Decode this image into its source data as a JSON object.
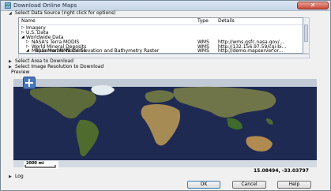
{
  "window": {
    "title": "Download Online Maps",
    "close_glyph": "✕"
  },
  "sections": {
    "data_source": "Select Data Source (right click for options)",
    "area": "Select Area to Download",
    "resolution": "Select Image Resolution to Download",
    "preview": "Preview",
    "log": "Log"
  },
  "table": {
    "headers": {
      "name": "Name",
      "type": "Type",
      "details": "Details"
    },
    "rows": [
      {
        "name": "Imagery",
        "type": "",
        "details": "",
        "expander": "▷"
      },
      {
        "name": "U.S. Data",
        "type": "",
        "details": "",
        "expander": "▷"
      },
      {
        "name": "Worldwide Data",
        "type": "",
        "details": "",
        "expander": "◢"
      },
      {
        "name": "NASA's Terra MODIS",
        "type": "WMS",
        "details": "http://wms.gsfc.nasa.gov/...",
        "expander": "▷"
      },
      {
        "name": "World Mineral Deposits",
        "type": "WMS",
        "details": "http://132.156.97.59/cgi-bi...",
        "expander": "▷"
      },
      {
        "name": "MapServer WMS Demo",
        "type": "WMS",
        "details": "http://demo.mapserver.or...",
        "expander": "◢"
      },
      {
        "name": "Blue Marble World Elevation and Bathymetry Raster",
        "type": "",
        "details": "",
        "expander": ""
      }
    ]
  },
  "map": {
    "zoom_in": "+",
    "scale_label": "2000 mi",
    "coordinates": "15.08494, -33.03797"
  },
  "buttons": {
    "ok": "OK",
    "cancel": "Cancel",
    "help": "Help"
  },
  "colors": {
    "ocean": "#1f2a52",
    "selection_text": "#1a3f8f",
    "primary_button_border": "#3c7fb1"
  }
}
